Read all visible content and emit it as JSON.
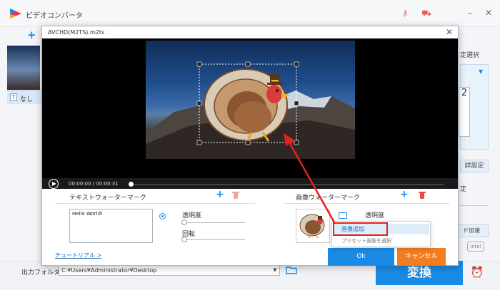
{
  "app": {
    "title": "ビデオコンバータ",
    "left_tag_label": "なし",
    "right_label_top": "定選択",
    "right_preset_text": "2",
    "right_button_1": "詳設定",
    "right_text_2": "定",
    "right_button_2": "ド加速",
    "intel_label": "intel",
    "output_folder_label": "出力フォルダ：",
    "output_folder_value": "C:¥Users¥Administrator¥Desktop",
    "convert_button": "変換"
  },
  "dialog": {
    "title": "AVCHD(M2TS).m2ts",
    "time": "00:00:00 / 00:00:31",
    "playback_progress": 0.0,
    "text_watermark": {
      "header": "テキストウォーターマーク",
      "text_value": "Hello World!",
      "opacity_label": "透明度",
      "rotate_label": "回転"
    },
    "image_watermark": {
      "header": "画像ウォーターマーク",
      "opacity_label": "透明度"
    },
    "tutorial_link": "チュートリアル >",
    "ok_button": "Ok",
    "cancel_button": "キャンセル"
  },
  "context_menu": {
    "items": [
      "画像追加",
      "プリセット画像を選択"
    ]
  },
  "colors": {
    "accent_blue": "#1a8be5",
    "cancel_orange": "#f57c1f",
    "highlight_red": "#e32020",
    "delete_red": "#e84b4b"
  }
}
